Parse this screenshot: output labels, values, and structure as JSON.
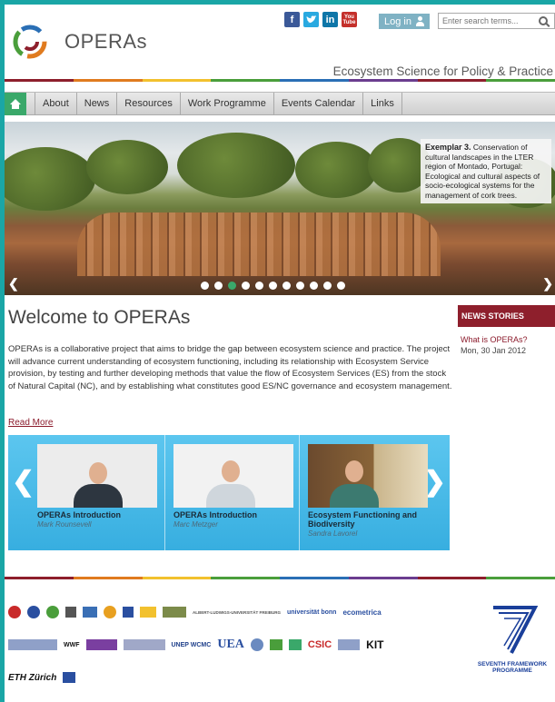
{
  "header": {
    "logo_text": "OPERAs",
    "tagline": "Ecosystem Science for Policy & Practice",
    "social": [
      "f",
      "in",
      "You\nTube"
    ],
    "login_label": "Log in",
    "search_placeholder": "Enter search terms..."
  },
  "nav": {
    "items": [
      "About",
      "News",
      "Resources",
      "Work Programme",
      "Events Calendar",
      "Links"
    ]
  },
  "hero": {
    "caption_bold": "Exemplar 3.",
    "caption_text": "Conservation of cultural landscapes in the LTER region of Montado, Portugal: Ecological and cultural aspects of socio-ecological systems for the management of cork trees.",
    "slide_count": 11,
    "active_slide": 3
  },
  "welcome": {
    "title": "Welcome to OPERAs",
    "body": "OPERAs is a collaborative project that aims to bridge the gap between ecosystem science and practice. The project will advance current understanding of ecosystem functioning, including its relationship with Ecosystem Service provision, by testing and further developing methods that value the flow of Ecosystem Services (ES) from the stock of Natural Capital (NC), and by establishing what constitutes good ES/NC governance and ecosystem management.",
    "read_more": "Read More"
  },
  "news": {
    "heading": "NEWS STORIES",
    "item_title": "What is OPERAs?",
    "item_date": "Mon, 30 Jan 2012"
  },
  "videos": [
    {
      "title": "OPERAs Introduction",
      "author": "Mark Rounsevell"
    },
    {
      "title": "OPERAs Introduction",
      "author": "Marc Metzger"
    },
    {
      "title": "Ecosystem Functioning and Biodiversity",
      "author": "Sandra Lavorel"
    }
  ],
  "partners": {
    "row1": [
      "ALBERT-LUDWIGS-UNIVERSITÄT FREIBURG",
      "universität bonn",
      "ecometrica"
    ],
    "row2": [
      "WWF",
      "UNEP WCMC",
      "UEA",
      "CSIC",
      "KIT"
    ],
    "row3": [
      "ETH Zürich"
    ],
    "fp7_label": "SEVENTH FRAMEWORK PROGRAMME"
  },
  "colors": {
    "accent_red": "#8e1f2c",
    "accent_green": "#3aa86a",
    "carousel_blue": "#37aee0",
    "frame_teal": "#1aa6a6"
  }
}
